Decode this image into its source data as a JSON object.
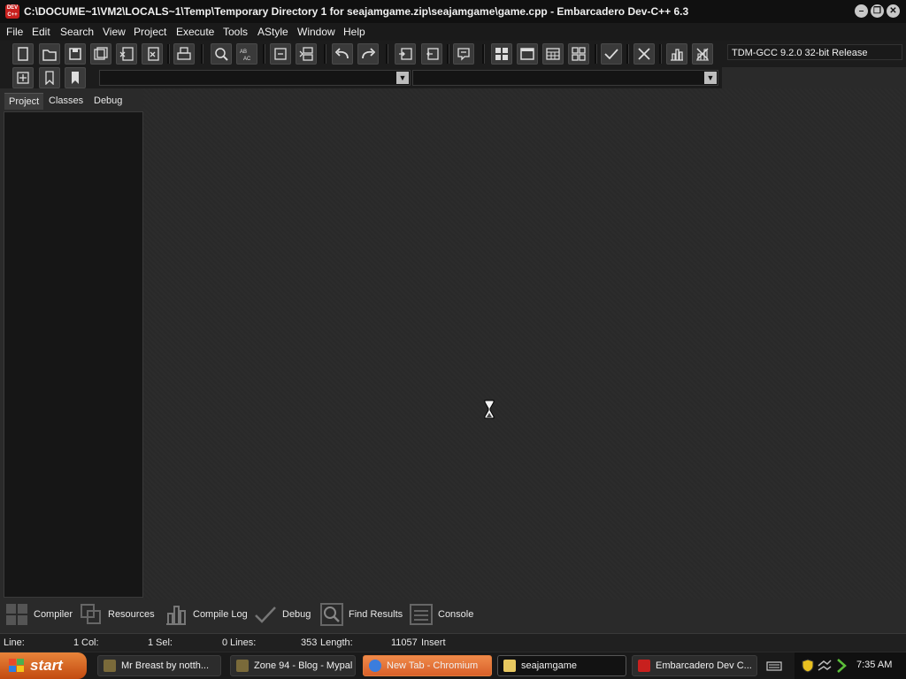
{
  "window": {
    "title": "C:\\DOCUME~1\\VM2\\LOCALS~1\\Temp\\Temporary Directory 1 for seajamgame.zip\\seajamgame\\game.cpp - Embarcadero Dev-C++ 6.3",
    "app_icon_text": "DEV C++",
    "minimize_label": "–",
    "restore_label": "❐",
    "close_label": "✕"
  },
  "menu": [
    "File",
    "Edit",
    "Search",
    "View",
    "Project",
    "Execute",
    "Tools",
    "AStyle",
    "Window",
    "Help"
  ],
  "toolbar": {
    "compiler_select": "TDM-GCC 9.2.0 32-bit Release",
    "icons": [
      "new-file-icon",
      "open-file-icon",
      "save-icon",
      "save-all-icon",
      "close-file-icon",
      "close-all-icon",
      "print-icon",
      "find-icon",
      "replace-icon",
      "goto-line-icon",
      "toggle-split-icon",
      "undo-icon",
      "redo-icon",
      "indent-icon",
      "unindent-icon",
      "comment-icon",
      "grid-view-icon",
      "window-view-icon",
      "table-view-icon",
      "tiles-view-icon",
      "check-icon",
      "stop-icon",
      "chart-icon",
      "cancel-icon"
    ]
  },
  "left_panel": {
    "tabs": [
      "Project",
      "Classes",
      "Debug"
    ],
    "active_tab": "Project"
  },
  "bottom_tabs": [
    "Compiler",
    "Resources",
    "Compile Log",
    "Debug",
    "Find Results",
    "Console"
  ],
  "status": {
    "line_label": "Line:",
    "line_value": "1",
    "col_label": "Col:",
    "col_value": "1",
    "sel_label": "Sel:",
    "sel_value": "0",
    "lines_label": "Lines:",
    "lines_value": "353",
    "length_label": "Length:",
    "length_value": "11057",
    "mode": "Insert"
  },
  "taskbar": {
    "start_label": "start",
    "tasks": [
      {
        "label": "Mr Breast by notth...",
        "state": "normal"
      },
      {
        "label": "Zone 94 - Blog - Mypal",
        "state": "normal"
      },
      {
        "label": "New Tab - Chromium",
        "state": "chrome"
      },
      {
        "label": "seajamgame",
        "state": "active"
      },
      {
        "label": "Embarcadero Dev C...",
        "state": "normal"
      }
    ],
    "clock": "7:35 AM"
  },
  "colors": {
    "accent": "#c8201e",
    "start": "#d8602a"
  }
}
